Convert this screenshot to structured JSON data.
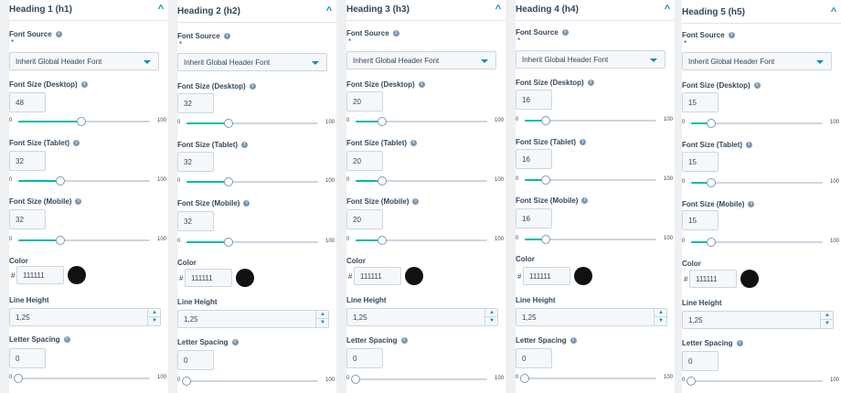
{
  "labels": {
    "font_source": "Font Source",
    "required_mark": "*",
    "size_desktop": "Font Size (Desktop)",
    "size_tablet": "Font Size (Tablet)",
    "size_mobile": "Font Size (Mobile)",
    "color": "Color",
    "hash": "#",
    "line_height": "Line Height",
    "letter_spacing": "Letter Spacing",
    "info_glyph": "i",
    "slider_min": "0",
    "slider_max": "100",
    "chevron_up": "^",
    "spin_up": "▲",
    "spin_down": "▼"
  },
  "colors": {
    "accent": "#0091ae",
    "slider_fill": "#00bda5",
    "swatch": "#111111"
  },
  "panels": [
    {
      "title": "Heading 1 (h1)",
      "font_source": "Inherit Global Header Font",
      "desktop": "48",
      "tablet": "32",
      "mobile": "32",
      "desktop_pct": 48,
      "tablet_pct": 32,
      "mobile_pct": 32,
      "color": "111111",
      "line_height": "1,25",
      "letter_spacing": "0",
      "letter_pct": 0
    },
    {
      "title": "Heading 2 (h2)",
      "font_source": "Inherit Global Header Font",
      "desktop": "32",
      "tablet": "32",
      "mobile": "32",
      "desktop_pct": 32,
      "tablet_pct": 32,
      "mobile_pct": 32,
      "color": "111111",
      "line_height": "1,25",
      "letter_spacing": "0",
      "letter_pct": 0
    },
    {
      "title": "Heading 3 (h3)",
      "font_source": "Inherit Global Header Font",
      "desktop": "20",
      "tablet": "20",
      "mobile": "20",
      "desktop_pct": 20,
      "tablet_pct": 20,
      "mobile_pct": 20,
      "color": "111111",
      "line_height": "1,25",
      "letter_spacing": "0",
      "letter_pct": 0
    },
    {
      "title": "Heading 4 (h4)",
      "font_source": "Inherit Global Header Font",
      "desktop": "16",
      "tablet": "16",
      "mobile": "16",
      "desktop_pct": 16,
      "tablet_pct": 16,
      "mobile_pct": 16,
      "color": "111111",
      "line_height": "1,25",
      "letter_spacing": "0",
      "letter_pct": 0
    },
    {
      "title": "Heading 5 (h5)",
      "font_source": "Inherit Global Header Font",
      "desktop": "15",
      "tablet": "15",
      "mobile": "15",
      "desktop_pct": 15,
      "tablet_pct": 15,
      "mobile_pct": 15,
      "color": "111111",
      "line_height": "1,25",
      "letter_spacing": "0",
      "letter_pct": 0
    }
  ]
}
